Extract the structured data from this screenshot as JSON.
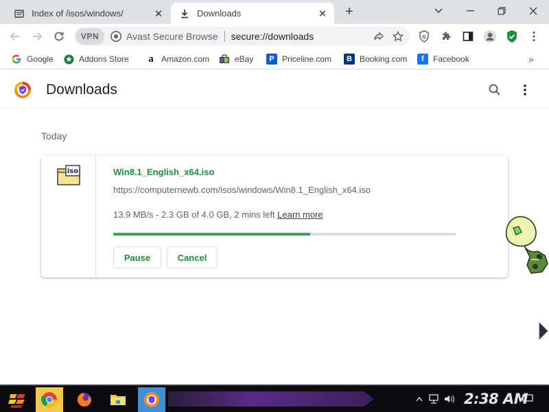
{
  "tabs": [
    {
      "title": "Index of /isos/windows/",
      "active": false
    },
    {
      "title": "Downloads",
      "active": true
    }
  ],
  "omnibox": {
    "vpn_label": "VPN",
    "site_name": "Avast Secure Browse",
    "url": "secure://downloads"
  },
  "bookmarks": [
    {
      "label": "Google",
      "icon": "google-icon"
    },
    {
      "label": "Addons Store",
      "icon": "addons-store-icon"
    },
    {
      "label": "Amazon.com",
      "icon": "amazon-icon"
    },
    {
      "label": "eBay",
      "icon": "ebay-icon"
    },
    {
      "label": "Priceline.com",
      "icon": "priceline-icon"
    },
    {
      "label": "Booking.com",
      "icon": "booking-icon"
    },
    {
      "label": "Facebook",
      "icon": "facebook-icon"
    }
  ],
  "page": {
    "title": "Downloads",
    "section_label": "Today"
  },
  "download": {
    "file_name": "Win8.1_English_x64.iso",
    "url": "https://computernewb.com/isos/windows/Win8.1_English_x64.iso",
    "status": "13.9 MB/s - 2.3 GB of 4.0 GB, 2 mins left",
    "learn_more": "Learn more",
    "progress_percent": 57.5,
    "pause_label": "Pause",
    "cancel_label": "Cancel",
    "icon_label": "iso"
  },
  "taskbar": {
    "clock": "2:38 AM"
  },
  "colors": {
    "accent_green": "#1e8e3e",
    "progress_green": "#34a853",
    "tab_strip": "#dee1e6"
  }
}
